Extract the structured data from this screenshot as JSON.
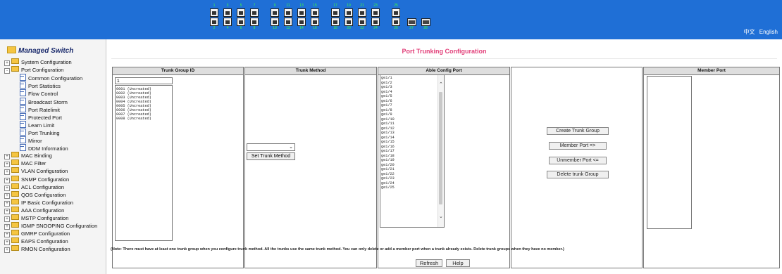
{
  "topbar": {
    "top_numbers": [
      "1",
      "3",
      "5",
      "7",
      "9",
      "11",
      "13",
      "15",
      "17",
      "19",
      "21",
      "23",
      "25"
    ],
    "bottom_numbers": [
      "2",
      "4",
      "6",
      "8",
      "10",
      "12",
      "14",
      "16",
      "18",
      "20",
      "22",
      "24",
      "26",
      "27",
      "28"
    ],
    "lang_zh": "中文",
    "lang_en": "English",
    "color": "#1f6fd6"
  },
  "sidebar": {
    "title": "Managed Switch",
    "items": [
      {
        "label": "System Configuration",
        "type": "folder",
        "level": 0
      },
      {
        "label": "Port Configuration",
        "type": "folder-open",
        "level": 0
      },
      {
        "label": "Common Configuration",
        "type": "doc",
        "level": 1
      },
      {
        "label": "Port Statistics",
        "type": "doc",
        "level": 1
      },
      {
        "label": "Flow Control",
        "type": "doc",
        "level": 1
      },
      {
        "label": "Broadcast Storm",
        "type": "doc",
        "level": 1
      },
      {
        "label": "Port Ratelimit",
        "type": "doc",
        "level": 1
      },
      {
        "label": "Protected Port",
        "type": "doc",
        "level": 1
      },
      {
        "label": "Learn Limit",
        "type": "doc",
        "level": 1
      },
      {
        "label": "Port Trunking",
        "type": "doc",
        "level": 1
      },
      {
        "label": "Mirror",
        "type": "doc",
        "level": 1
      },
      {
        "label": "DDM Information",
        "type": "doc",
        "level": 1
      },
      {
        "label": "MAC Binding",
        "type": "folder",
        "level": 0
      },
      {
        "label": "MAC Filter",
        "type": "folder",
        "level": 0
      },
      {
        "label": "VLAN Configuration",
        "type": "folder",
        "level": 0
      },
      {
        "label": "SNMP Configuration",
        "type": "folder",
        "level": 0
      },
      {
        "label": "ACL Configuration",
        "type": "folder",
        "level": 0
      },
      {
        "label": "QOS Configuration",
        "type": "folder",
        "level": 0
      },
      {
        "label": "IP Basic Configuration",
        "type": "folder",
        "level": 0
      },
      {
        "label": "AAA Configuration",
        "type": "folder",
        "level": 0
      },
      {
        "label": "MSTP Configuration",
        "type": "folder",
        "level": 0
      },
      {
        "label": "IGMP SNOOPING Configuration",
        "type": "folder",
        "level": 0
      },
      {
        "label": "GMRP Configuration",
        "type": "folder",
        "level": 0
      },
      {
        "label": "EAPS Configuration",
        "type": "folder",
        "level": 0
      },
      {
        "label": "RMON Configuration",
        "type": "folder",
        "level": 0
      }
    ]
  },
  "main": {
    "title": "Port Trunking Configuration",
    "columns": {
      "trunk_group_id": "Trunk Group ID",
      "trunk_method": "Trunk Method",
      "able_config_port": "Able Config Port",
      "member_port": "Member Port"
    },
    "group_id_value": "1",
    "groups": [
      "0001 (Uncreated)",
      "0002 (Uncreated)",
      "0003 (Uncreated)",
      "0004 (Uncreated)",
      "0005 (Uncreated)",
      "0006 (Uncreated)",
      "0007 (Uncreated)",
      "0008 (Uncreated)"
    ],
    "set_method_label": "Set Trunk Method",
    "ports": [
      "ge1/1",
      "ge1/2",
      "ge1/3",
      "ge1/4",
      "ge1/5",
      "ge1/6",
      "ge1/7",
      "ge1/8",
      "ge1/9",
      "ge1/10",
      "ge1/11",
      "ge1/12",
      "ge1/13",
      "ge1/14",
      "ge1/15",
      "ge1/16",
      "ge1/17",
      "ge1/18",
      "ge1/19",
      "ge1/20",
      "ge1/21",
      "ge1/22",
      "ge1/23",
      "ge1/24",
      "ge1/25"
    ],
    "create_label": "Create Trunk Group",
    "member_label": "Member Port =>",
    "unmember_label": "Unmember Port <=",
    "delete_label": "Delete trunk Group",
    "note": "(Note: There must have at least one trunk group when you configure trunk method. All the trunks use the same trunk method. You can only delete or add a member port when a trunk already exists. Delete trunk groups when they have no member.)",
    "refresh_label": "Refresh",
    "help_label": "Help"
  }
}
